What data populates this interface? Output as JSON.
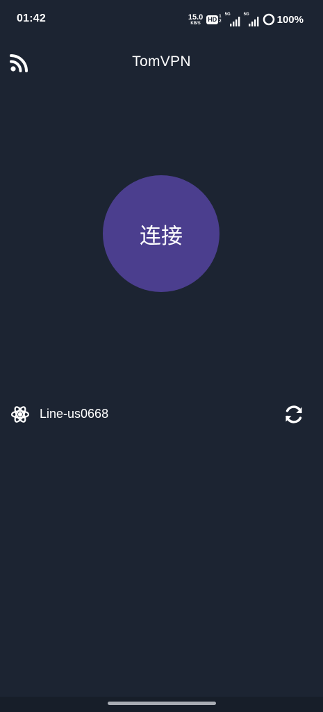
{
  "status_bar": {
    "time": "01:42",
    "net_speed_value": "15.0",
    "net_speed_unit": "KB/S",
    "hd_label": "HD",
    "hd_sim_top": "1",
    "hd_sim_bottom": "2",
    "sim1_label": "5G",
    "sim2_label": "5G",
    "battery": "100%"
  },
  "app_bar": {
    "title": "TomVPN",
    "left_icon": "rss-feed-icon"
  },
  "connect": {
    "label": "连接",
    "color": "#4b3e8e"
  },
  "line": {
    "name": "Line-us0668",
    "icon": "atom-icon",
    "refresh_icon": "refresh-icon"
  },
  "colors": {
    "background": "#1c2432",
    "nav_bar": "#171e29",
    "text": "#ffffff"
  }
}
